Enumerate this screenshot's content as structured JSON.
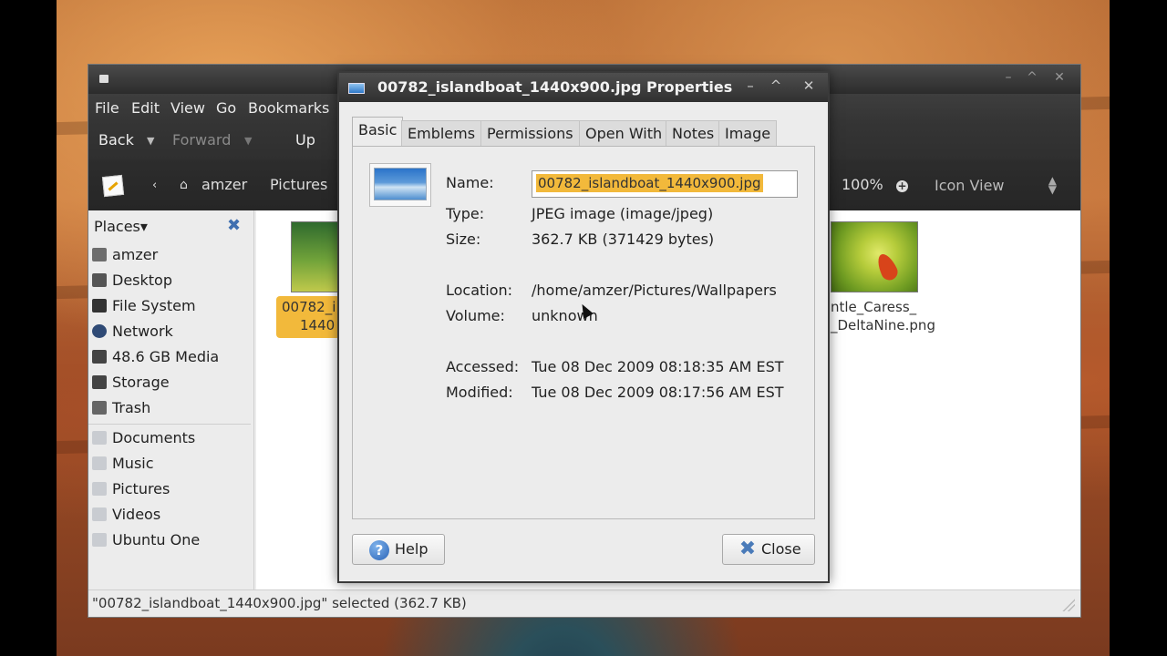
{
  "file_manager": {
    "menubar": [
      "File",
      "Edit",
      "View",
      "Go",
      "Bookmarks"
    ],
    "toolbar": {
      "back": "Back",
      "forward": "Forward",
      "up": "Up"
    },
    "location": {
      "crumbs": [
        "amzer",
        "Pictures"
      ],
      "zoom": "100%",
      "view_mode": "Icon View"
    },
    "sidebar": {
      "header": "Places",
      "places": [
        {
          "label": "amzer",
          "icon": "home-icon"
        },
        {
          "label": "Desktop",
          "icon": "desktop-icon"
        },
        {
          "label": "File System",
          "icon": "harddisk-icon"
        },
        {
          "label": "Network",
          "icon": "network-icon"
        },
        {
          "label": "48.6 GB Media",
          "icon": "drive-icon"
        },
        {
          "label": "Storage",
          "icon": "drive-icon"
        },
        {
          "label": "Trash",
          "icon": "trash-icon"
        }
      ],
      "bookmarks": [
        {
          "label": "Documents",
          "icon": "folder-icon"
        },
        {
          "label": "Music",
          "icon": "folder-icon"
        },
        {
          "label": "Pictures",
          "icon": "folder-icon"
        },
        {
          "label": "Videos",
          "icon": "folder-icon"
        },
        {
          "label": "Ubuntu One",
          "icon": "folder-icon"
        }
      ]
    },
    "files": [
      {
        "label_line1": "00782_i",
        "label_line2": "1440",
        "selected": true
      },
      {
        "label_line1": "ntle_Caress_",
        "label_line2": "_DeltaNine.png",
        "selected": false
      }
    ],
    "status": "\"00782_islandboat_1440x900.jpg\" selected (362.7 KB)"
  },
  "dialog": {
    "title": "00782_islandboat_1440x900.jpg Properties",
    "tabs": [
      "Basic",
      "Emblems",
      "Permissions",
      "Open With",
      "Notes",
      "Image"
    ],
    "active_tab": "Basic",
    "properties": {
      "name_label": "Name:",
      "name_value": "00782_islandboat_1440x900.jpg",
      "type_label": "Type:",
      "type_value": "JPEG image (image/jpeg)",
      "size_label": "Size:",
      "size_value": "362.7 KB (371429 bytes)",
      "location_label": "Location:",
      "location_value": "/home/amzer/Pictures/Wallpapers",
      "volume_label": "Volume:",
      "volume_value": "unknown",
      "accessed_label": "Accessed:",
      "accessed_value": "Tue 08 Dec 2009 08:18:35 AM EST",
      "modified_label": "Modified:",
      "modified_value": "Tue 08 Dec 2009 08:17:56 AM EST"
    },
    "buttons": {
      "help": "Help",
      "close": "Close"
    }
  },
  "colors": {
    "selection": "#f2b93b",
    "dark_chrome": "#353535",
    "accent_blue": "#3f6fb0"
  }
}
